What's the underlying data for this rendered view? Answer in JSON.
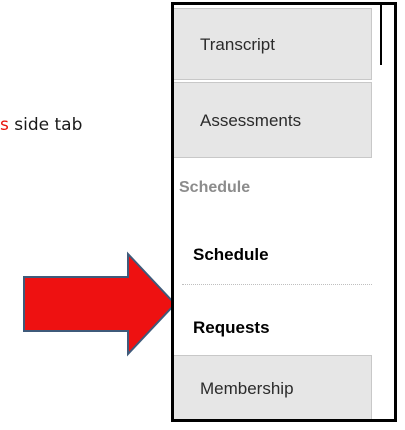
{
  "instruction": {
    "highlight": "s",
    "rest": " side tab"
  },
  "sidebar": {
    "tabs": {
      "transcript": "Transcript",
      "assessments": "Assessments",
      "membership": "Membership"
    },
    "section_header": "Schedule",
    "items": {
      "schedule": "Schedule",
      "requests": "Requests"
    }
  },
  "colors": {
    "highlight_text": "#e8120c",
    "arrow_fill": "#ee1111",
    "arrow_stroke": "#3f5a7a",
    "tab_background": "#e6e6e6"
  },
  "icons": {
    "pointer_arrow": "right-arrow-icon"
  }
}
